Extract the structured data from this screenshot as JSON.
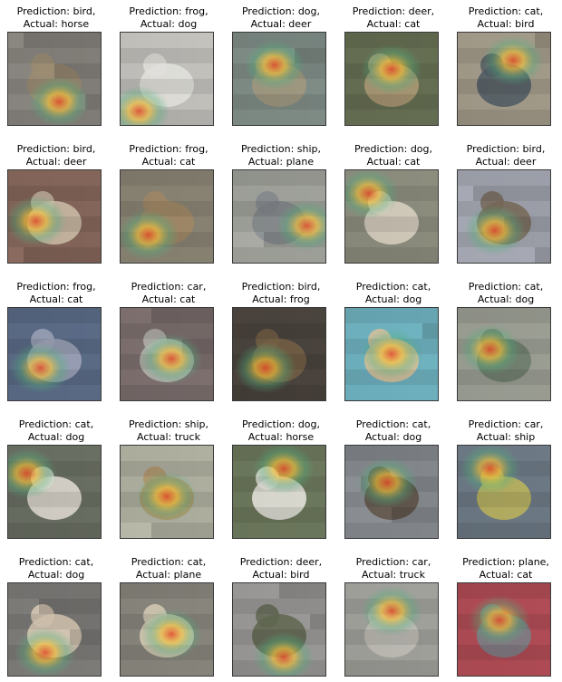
{
  "grid": {
    "cells": [
      {
        "prediction": "Prediction: bird,",
        "actual": "Actual: horse",
        "subject": "horse",
        "scene": {
          "bg": "#8a8680",
          "fg": "#9c8d72",
          "spot": [
            0.55,
            0.75
          ]
        }
      },
      {
        "prediction": "Prediction: frog,",
        "actual": "Actual: dog",
        "subject": "dog",
        "scene": {
          "bg": "#c9c7c2",
          "fg": "#ecebe6",
          "spot": [
            0.2,
            0.85
          ]
        }
      },
      {
        "prediction": "Prediction: dog,",
        "actual": "Actual: deer",
        "subject": "deer",
        "scene": {
          "bg": "#7f8c86",
          "fg": "#a39a80",
          "spot": [
            0.45,
            0.35
          ]
        }
      },
      {
        "prediction": "Prediction: deer,",
        "actual": "Actual: cat",
        "subject": "cat",
        "scene": {
          "bg": "#6a7356",
          "fg": "#b9a27c",
          "spot": [
            0.5,
            0.4
          ]
        }
      },
      {
        "prediction": "Prediction: cat,",
        "actual": "Actual: bird",
        "subject": "bird",
        "scene": {
          "bg": "#a39b8a",
          "fg": "#4f5a63",
          "spot": [
            0.6,
            0.3
          ]
        }
      },
      {
        "prediction": "Prediction: bird,",
        "actual": "Actual: deer",
        "subject": "deer",
        "scene": {
          "bg": "#8a6a5e",
          "fg": "#d8c9b3",
          "spot": [
            0.3,
            0.55
          ]
        }
      },
      {
        "prediction": "Prediction: frog,",
        "actual": "Actual: cat",
        "subject": "cat",
        "scene": {
          "bg": "#8a8474",
          "fg": "#a48a66",
          "spot": [
            0.3,
            0.7
          ]
        }
      },
      {
        "prediction": "Prediction: ship,",
        "actual": "Actual: plane",
        "subject": "plane",
        "scene": {
          "bg": "#a8aaa3",
          "fg": "#8a8f93",
          "spot": [
            0.8,
            0.6
          ]
        }
      },
      {
        "prediction": "Prediction: dog,",
        "actual": "Actual: cat",
        "subject": "cat",
        "scene": {
          "bg": "#8f8f80",
          "fg": "#e2d8c8",
          "spot": [
            0.25,
            0.25
          ]
        }
      },
      {
        "prediction": "Prediction: bird,",
        "actual": "Actual: deer",
        "subject": "deer",
        "scene": {
          "bg": "#a6a9b3",
          "fg": "#7e6e5c",
          "spot": [
            0.4,
            0.65
          ]
        }
      },
      {
        "prediction": "Prediction: frog,",
        "actual": "Actual: cat",
        "subject": "cat",
        "scene": {
          "bg": "#5d6e8a",
          "fg": "#a7adc2",
          "spot": [
            0.35,
            0.65
          ]
        }
      },
      {
        "prediction": "Prediction: car,",
        "actual": "Actual: cat",
        "subject": "cat",
        "scene": {
          "bg": "#7c6f6e",
          "fg": "#b8b8b2",
          "spot": [
            0.55,
            0.55
          ]
        }
      },
      {
        "prediction": "Prediction: bird,",
        "actual": "Actual: frog",
        "subject": "frog",
        "scene": {
          "bg": "#4d4640",
          "fg": "#7a6448",
          "spot": [
            0.35,
            0.65
          ]
        }
      },
      {
        "prediction": "Prediction: cat,",
        "actual": "Actual: dog",
        "subject": "dog",
        "scene": {
          "bg": "#6fb2c0",
          "fg": "#e4c49a",
          "spot": [
            0.5,
            0.5
          ]
        }
      },
      {
        "prediction": "Prediction: cat,",
        "actual": "Actual: dog",
        "subject": "dog",
        "scene": {
          "bg": "#a2a59a",
          "fg": "#70806e",
          "spot": [
            0.35,
            0.45
          ]
        }
      },
      {
        "prediction": "Prediction: cat,",
        "actual": "Actual: dog",
        "subject": "dog",
        "scene": {
          "bg": "#6a6f63",
          "fg": "#e6e2d8",
          "spot": [
            0.2,
            0.3
          ]
        }
      },
      {
        "prediction": "Prediction: ship,",
        "actual": "Actual: truck",
        "subject": "truck",
        "scene": {
          "bg": "#b8b8a8",
          "fg": "#bc9a6a",
          "spot": [
            0.5,
            0.55
          ]
        }
      },
      {
        "prediction": "Prediction: dog,",
        "actual": "Actual: horse",
        "subject": "horse",
        "scene": {
          "bg": "#6e7a5e",
          "fg": "#f1efe8",
          "spot": [
            0.55,
            0.25
          ]
        }
      },
      {
        "prediction": "Prediction: cat,",
        "actual": "Actual: dog",
        "subject": "dog",
        "scene": {
          "bg": "#8b8f94",
          "fg": "#5f5346",
          "spot": [
            0.45,
            0.4
          ]
        }
      },
      {
        "prediction": "Prediction: car,",
        "actual": "Actual: ship",
        "subject": "ship",
        "scene": {
          "bg": "#6f7c88",
          "fg": "#c6bc5e",
          "spot": [
            0.35,
            0.25
          ]
        }
      },
      {
        "prediction": "Prediction: cat,",
        "actual": "Actual: dog",
        "subject": "dog",
        "scene": {
          "bg": "#7d7b78",
          "fg": "#e0d1bb",
          "spot": [
            0.4,
            0.75
          ]
        }
      },
      {
        "prediction": "Prediction: cat,",
        "actual": "Actual: plane",
        "subject": "plane",
        "scene": {
          "bg": "#8c8980",
          "fg": "#e4d8c0",
          "spot": [
            0.55,
            0.55
          ]
        }
      },
      {
        "prediction": "Prediction: deer,",
        "actual": "Actual: bird",
        "subject": "bird",
        "scene": {
          "bg": "#9a9896",
          "fg": "#5f6650",
          "spot": [
            0.55,
            0.8
          ]
        }
      },
      {
        "prediction": "Prediction: car,",
        "actual": "Actual: truck",
        "subject": "truck",
        "scene": {
          "bg": "#a7a7a2",
          "fg": "#c9c7be",
          "spot": [
            0.5,
            0.3
          ]
        }
      },
      {
        "prediction": "Prediction: plane,",
        "actual": "Actual: cat",
        "subject": "cat",
        "scene": {
          "bg": "#b04c55",
          "fg": "#7b848c",
          "spot": [
            0.45,
            0.4
          ]
        }
      }
    ]
  },
  "colors": {
    "caption": "#000000",
    "frame": "#3a3a3a",
    "heat_hot": "#e34a2a",
    "heat_warm": "#f4c23a",
    "heat_cool": "#52b07a"
  }
}
